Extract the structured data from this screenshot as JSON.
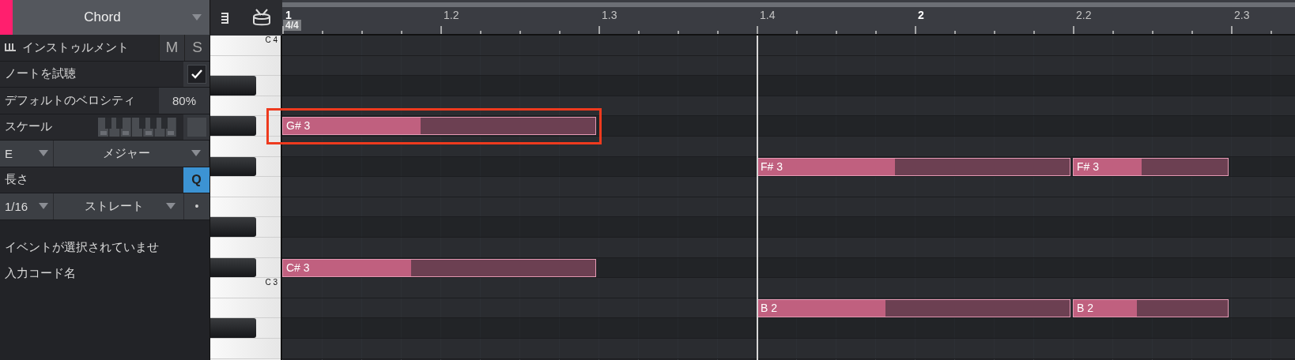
{
  "track": {
    "title": "Chord"
  },
  "inspector": {
    "instrument": {
      "label": "インストゥルメント",
      "mute": "M",
      "solo": "S"
    },
    "audition": {
      "label": "ノートを試聴",
      "checked": true
    },
    "velocity": {
      "label": "デフォルトのベロシティ",
      "value": "80%"
    },
    "scale": {
      "label": "スケール"
    },
    "root": "E",
    "mode": "メジャー",
    "length": {
      "label": "長さ",
      "quantize": "Q",
      "quantize_on": true
    },
    "grid": "1/16",
    "timing": "ストレート",
    "dot": "•",
    "status": "イベントが選択されていませ",
    "chord_name": "入力コード名"
  },
  "time_signature": "4/4",
  "ruler": [
    {
      "label": "1",
      "kind": "bar",
      "cursor": false
    },
    {
      "label": "1.2",
      "kind": "beat",
      "cursor": false
    },
    {
      "label": "1.3",
      "kind": "beat",
      "cursor": false
    },
    {
      "label": "1.4",
      "kind": "beat",
      "cursor": true
    },
    {
      "label": "2",
      "kind": "bar",
      "cursor": false
    },
    {
      "label": "2.2",
      "kind": "beat",
      "cursor": false
    },
    {
      "label": "2.3",
      "kind": "beat",
      "cursor": false
    }
  ],
  "rows": [
    {
      "kind": "white",
      "key_label": "C 4"
    },
    {
      "kind": "white"
    },
    {
      "kind": "black"
    },
    {
      "kind": "white"
    },
    {
      "kind": "black",
      "notes": [
        {
          "label": "G# 3",
          "level": 0.44,
          "highlighted": true
        }
      ]
    },
    {
      "kind": "white"
    },
    {
      "kind": "black",
      "notes": [
        {
          "label": "F# 3",
          "level": 0.44,
          "highlighted": false
        },
        {
          "label": "F# 3",
          "level": 0.44,
          "highlighted": false
        }
      ]
    },
    {
      "kind": "white"
    },
    {
      "kind": "white"
    },
    {
      "kind": "black"
    },
    {
      "kind": "white"
    },
    {
      "kind": "black",
      "notes": [
        {
          "label": "C# 3",
          "level": 0.41,
          "highlighted": false
        }
      ]
    },
    {
      "kind": "white",
      "key_label": "C 3"
    },
    {
      "kind": "white",
      "notes": [
        {
          "label": "B 2",
          "level": 0.41,
          "highlighted": false
        },
        {
          "label": "B 2",
          "level": 0.41,
          "highlighted": false
        }
      ]
    },
    {
      "kind": "black"
    },
    {
      "kind": "white"
    }
  ]
}
